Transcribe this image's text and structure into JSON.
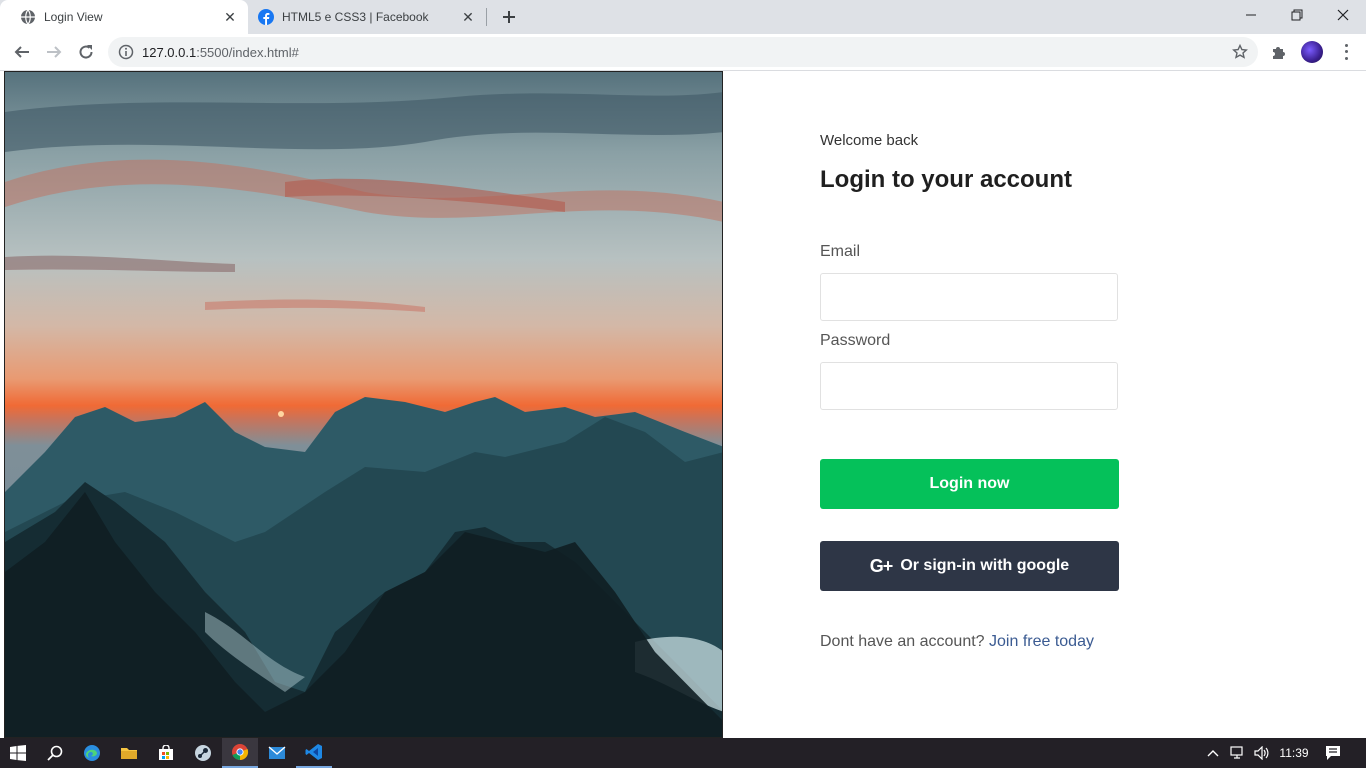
{
  "browser": {
    "tabs": [
      {
        "title": "Login View",
        "active": true
      },
      {
        "title": "HTML5 e CSS3 | Facebook",
        "active": false
      }
    ],
    "url_host": "127.0.0.1",
    "url_rest": ":5500/index.html#"
  },
  "login": {
    "welcome": "Welcome back",
    "heading": "Login to your account",
    "email_label": "Email",
    "email_value": "",
    "password_label": "Password",
    "password_value": "",
    "login_button": "Login now",
    "google_icon": "G+",
    "google_button": "Or sign-in with google",
    "signup_prompt": "Dont have an account?",
    "signup_link": "Join free today"
  },
  "colors": {
    "login_button": "#05c15a",
    "google_button": "#2e3646",
    "link": "#3b5b92"
  },
  "taskbar": {
    "time": "11:39",
    "apps": [
      "start-icon",
      "search-icon",
      "edge-icon",
      "file-explorer-icon",
      "store-icon",
      "steam-icon",
      "chrome-icon",
      "mail-icon",
      "vscode-icon"
    ]
  }
}
